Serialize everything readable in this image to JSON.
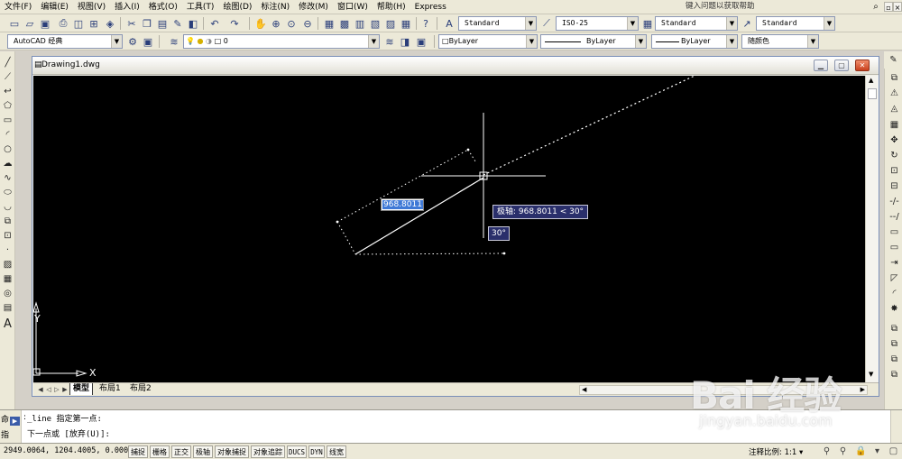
{
  "menubar": {
    "items": [
      "文件(F)",
      "编辑(E)",
      "视图(V)",
      "插入(I)",
      "格式(O)",
      "工具(T)",
      "绘图(D)",
      "标注(N)",
      "修改(M)",
      "窗口(W)",
      "帮助(H)",
      "Express"
    ],
    "help_placeholder": "键入问题以获取帮助"
  },
  "toolbar1": {
    "text_style": "Standard",
    "dim_style": "ISO-25",
    "table_style": "Standard",
    "multileader_style": "Standard"
  },
  "toolbar2": {
    "workspace": "AutoCAD 经典",
    "layer": "0",
    "color": "ByLayer",
    "linetype": "ByLayer",
    "lineweight": "ByLayer",
    "plotstyle": "随颜色"
  },
  "drawing": {
    "title": "Drawing1.dwg",
    "dyn_value": "968.8011",
    "polar_tooltip": "极轴: 968.8011 < 30°",
    "angle_tooltip": "30°",
    "ucs_x": "X",
    "ucs_y": "Y",
    "tabs": [
      "模型",
      "布局1",
      "布局2"
    ]
  },
  "command": {
    "line1": "_line 指定第一点:",
    "line2": "下一点或 [放弃(U)]:",
    "prefix1": "命",
    "prefix2": "指"
  },
  "status": {
    "coords": "2949.0064, 1204.4005, 0.0000",
    "toggles": [
      "捕捉",
      "栅格",
      "正交",
      "极轴",
      "对象捕捉",
      "对象追踪",
      "DUCS",
      "DYN",
      "线宽"
    ],
    "annotation_scale_label": "注释比例:",
    "annotation_scale_value": "1:1"
  },
  "watermark": {
    "main": "Bai 经验",
    "sub": "jingyan.baidu.com"
  }
}
